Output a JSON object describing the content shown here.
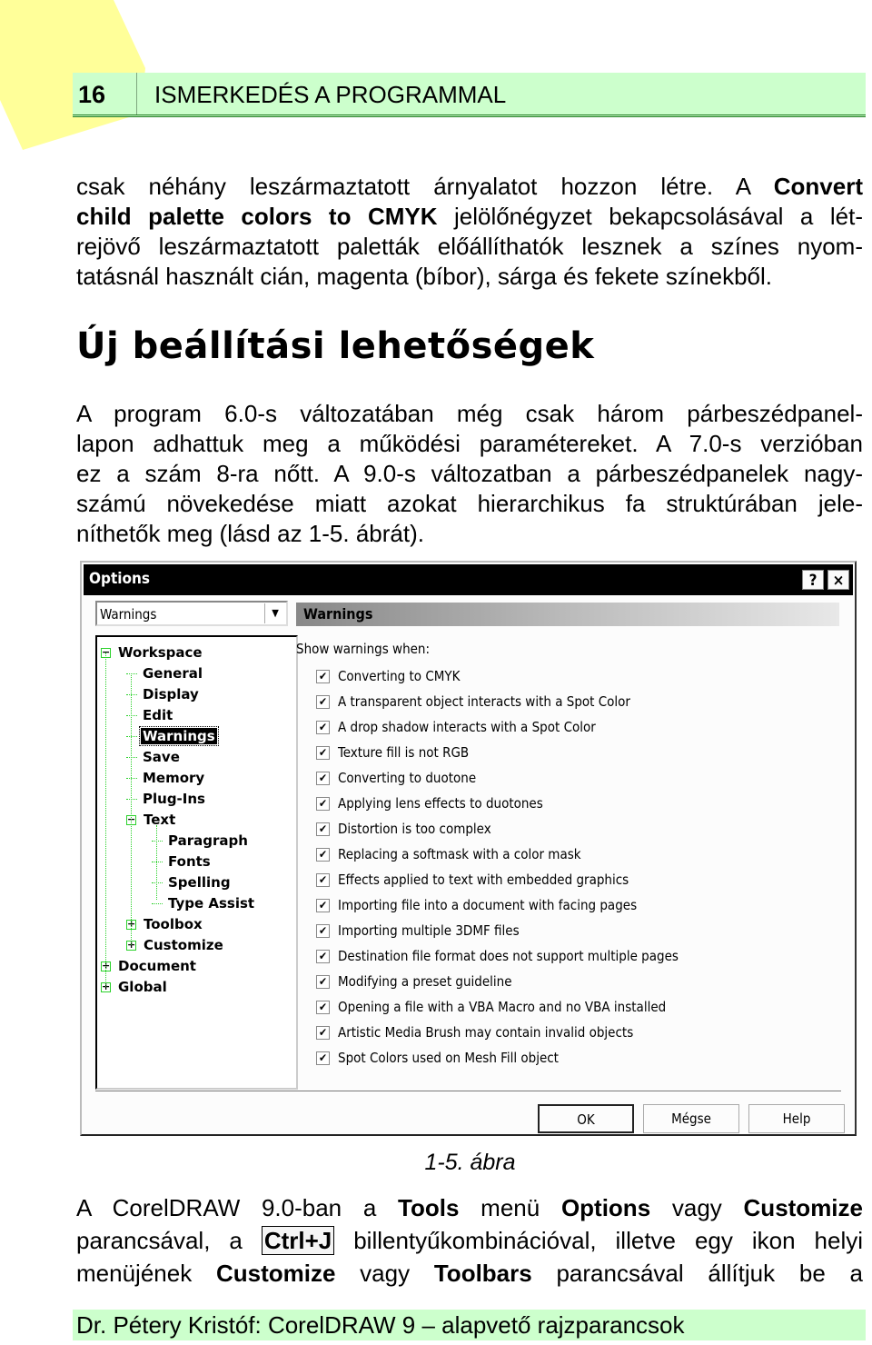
{
  "page_header": {
    "page_number": "16",
    "chapter_title": "ISMERKEDÉS A PROGRAMMAL"
  },
  "paragraph1": {
    "lines": [
      [
        "csak néhány leszármaztatott árnyalatot hozzon létre. A ",
        {
          "b": "Convert"
        }
      ],
      [
        {
          "b": "child palette colors to CMYK"
        },
        " jelölőnégyzet bekapcsolásával a lét-"
      ],
      [
        "rejövő leszármaztatott paletták előállíthatók lesznek a színes nyom-"
      ],
      [
        "tatásnál használt cián, magenta (bíbor), sárga és fekete színekből."
      ]
    ]
  },
  "section_heading": "Új beállítási lehetőségek",
  "paragraph2": {
    "lines": [
      "A program 6.0-s változatában még csak három párbeszédpanel-",
      "lapon adhattuk meg a működési paramétereket. A 7.0-s verzióban",
      "ez a szám 8-ra nőtt. A 9.0-s változatban a párbeszédpanelek nagy-",
      "számú növekedése miatt azokat hierarchikus fa struktúrában jele-",
      "níthetők meg (lásd az 1-5. ábrát)."
    ]
  },
  "dialog": {
    "title": "Options",
    "help_button": "?",
    "close_button": "×",
    "category_combo": {
      "value": "Warnings"
    },
    "panel_title": "Warnings",
    "show_label": "Show warnings when:",
    "tree": [
      {
        "label": "Workspace",
        "level": 0,
        "toggle": "−"
      },
      {
        "label": "General",
        "level": 1
      },
      {
        "label": "Display",
        "level": 1
      },
      {
        "label": "Edit",
        "level": 1
      },
      {
        "label": "Warnings",
        "level": 1,
        "selected": true
      },
      {
        "label": "Save",
        "level": 1
      },
      {
        "label": "Memory",
        "level": 1
      },
      {
        "label": "Plug-Ins",
        "level": 1
      },
      {
        "label": "Text",
        "level": 1,
        "toggle": "−"
      },
      {
        "label": "Paragraph",
        "level": 2
      },
      {
        "label": "Fonts",
        "level": 2
      },
      {
        "label": "Spelling",
        "level": 2
      },
      {
        "label": "Type Assist",
        "level": 2
      },
      {
        "label": "Toolbox",
        "level": 1,
        "toggle": "+"
      },
      {
        "label": "Customize",
        "level": 1,
        "toggle": "+"
      },
      {
        "label": "Document",
        "level": 0,
        "toggle": "+"
      },
      {
        "label": "Global",
        "level": 0,
        "toggle": "+"
      }
    ],
    "warnings": [
      {
        "label": "Converting to CMYK",
        "checked": true
      },
      {
        "label": "A transparent object interacts with a Spot Color",
        "checked": true
      },
      {
        "label": "A drop shadow interacts with a Spot Color",
        "checked": true
      },
      {
        "label": "Texture fill is not RGB",
        "checked": true
      },
      {
        "label": "Converting to duotone",
        "checked": true
      },
      {
        "label": "Applying lens effects to duotones",
        "checked": true
      },
      {
        "label": "Distortion is too complex",
        "checked": true
      },
      {
        "label": "Replacing a softmask with a color mask",
        "checked": true
      },
      {
        "label": "Effects applied to text with embedded graphics",
        "checked": true
      },
      {
        "label": "Importing file into a document with facing pages",
        "checked": true
      },
      {
        "label": "Importing multiple 3DMF files",
        "checked": true
      },
      {
        "label": "Destination file format does not support multiple pages",
        "checked": true
      },
      {
        "label": "Modifying a preset guideline",
        "checked": true
      },
      {
        "label": "Opening a file with a VBA Macro and no VBA installed",
        "checked": true
      },
      {
        "label": "Artistic Media Brush may contain invalid objects",
        "checked": true
      },
      {
        "label": "Spot Colors used on Mesh Fill object",
        "checked": true
      }
    ],
    "buttons": {
      "ok": "OK",
      "cancel": "Mégse",
      "help": "Help"
    }
  },
  "figure_caption": "1-5. ábra",
  "paragraph3": {
    "lines": [
      [
        "A CorelDRAW 9.0-ban a ",
        {
          "b": "Tools"
        },
        " menü ",
        {
          "b": "Options"
        },
        " vagy ",
        {
          "b": "Customize"
        }
      ],
      [
        "parancsával, a ",
        {
          "kbd": "Ctrl+J"
        },
        " billentyűkombinációval, illetve egy ikon helyi"
      ],
      [
        "menüjének ",
        {
          "b": "Customize"
        },
        " vagy ",
        {
          "b": "Toolbars"
        },
        " parancsával állítjuk be a"
      ]
    ]
  },
  "footer": {
    "text": "Dr. Pétery Kristóf: CorelDRAW 9 – alapvető rajzparancsok"
  },
  "colors": {
    "band_green": "#ccffcc",
    "rule_green": "#1f7a1f",
    "corner_yellow": "#ffff99",
    "tree_line_green": "#2bd12b"
  }
}
